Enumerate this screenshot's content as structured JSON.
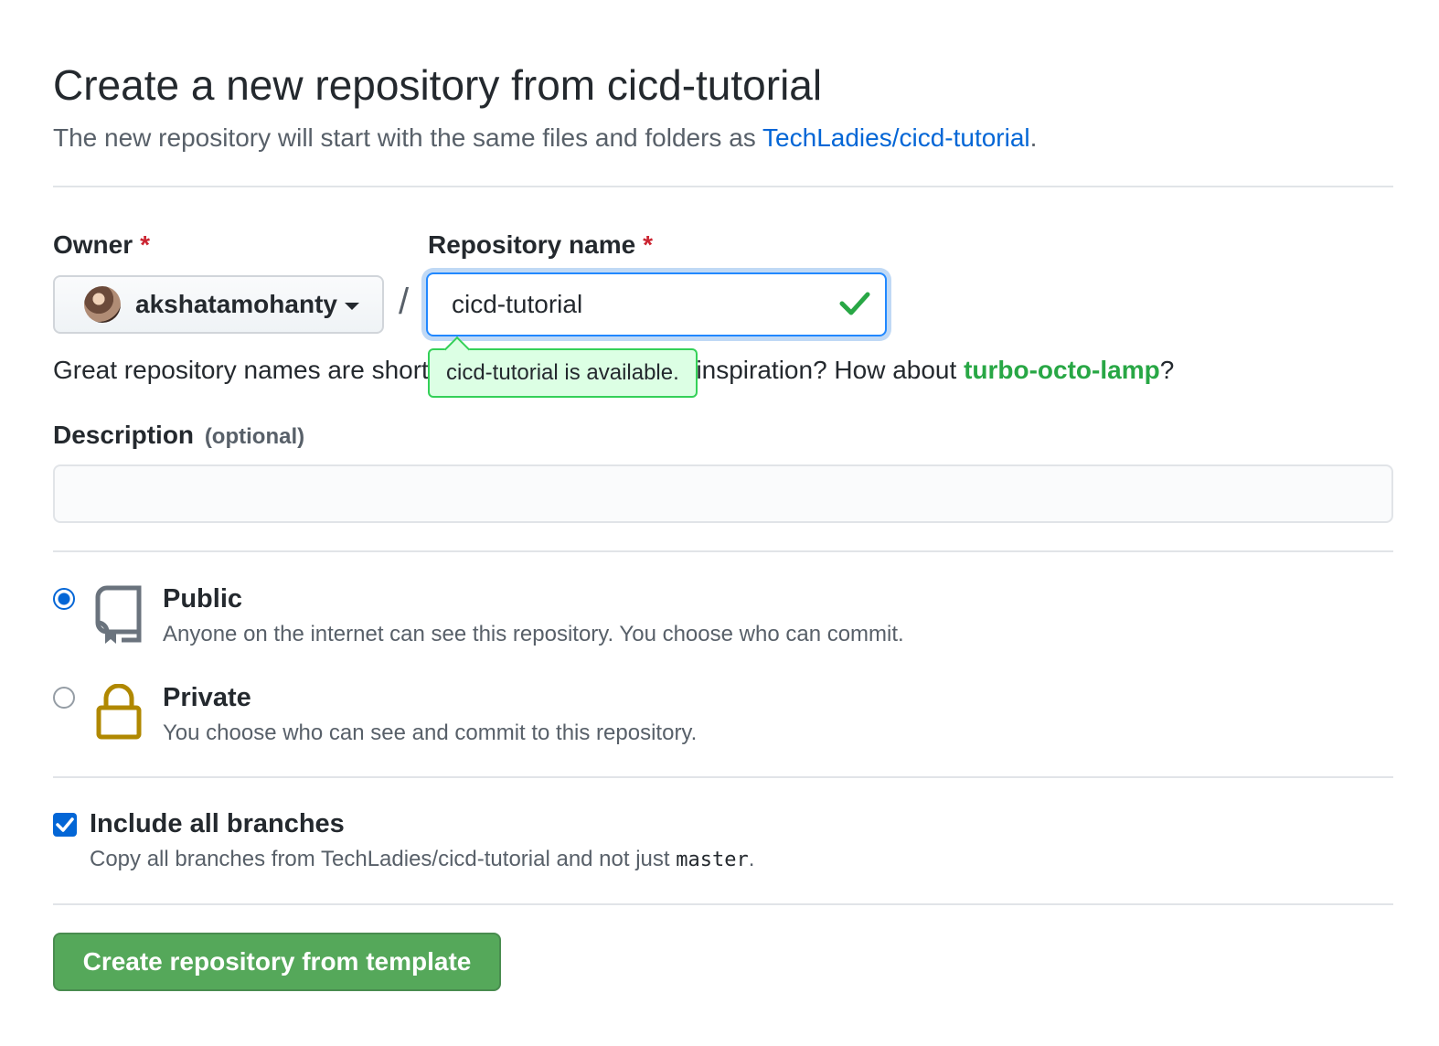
{
  "header": {
    "title": "Create a new repository from cicd-tutorial",
    "subtitle_prefix": "The new repository will start with the same files and folders as ",
    "template_link": "TechLadies/cicd-tutorial",
    "subtitle_suffix": "."
  },
  "owner": {
    "label": "Owner",
    "required_mark": "*",
    "value": "akshatamohanty"
  },
  "repo_name": {
    "label": "Repository name",
    "required_mark": "*",
    "value": "cicd-tutorial",
    "slash": "/",
    "availability": "cicd-tutorial is available."
  },
  "hint": {
    "text": "Great repository names are short and memorable. Need inspiration? How about ",
    "suggestion": "turbo-octo-lamp",
    "end": "?"
  },
  "description": {
    "label": "Description",
    "optional": "(optional)",
    "value": ""
  },
  "visibility": {
    "selected": "public",
    "options": [
      {
        "id": "public",
        "title": "Public",
        "note": "Anyone on the internet can see this repository. You choose who can commit.",
        "icon": "repo-icon"
      },
      {
        "id": "private",
        "title": "Private",
        "note": "You choose who can see and commit to this repository.",
        "icon": "lock-icon"
      }
    ]
  },
  "include_branches": {
    "checked": true,
    "title": "Include all branches",
    "note_prefix": "Copy all branches from TechLadies/cicd-tutorial and not just ",
    "note_code": "master",
    "note_suffix": "."
  },
  "submit": {
    "label": "Create repository from template"
  },
  "colors": {
    "link": "#0366d6",
    "required": "#cb2431",
    "success": "#28a745",
    "primary_button": "#55a85a",
    "lock": "#b08800"
  }
}
